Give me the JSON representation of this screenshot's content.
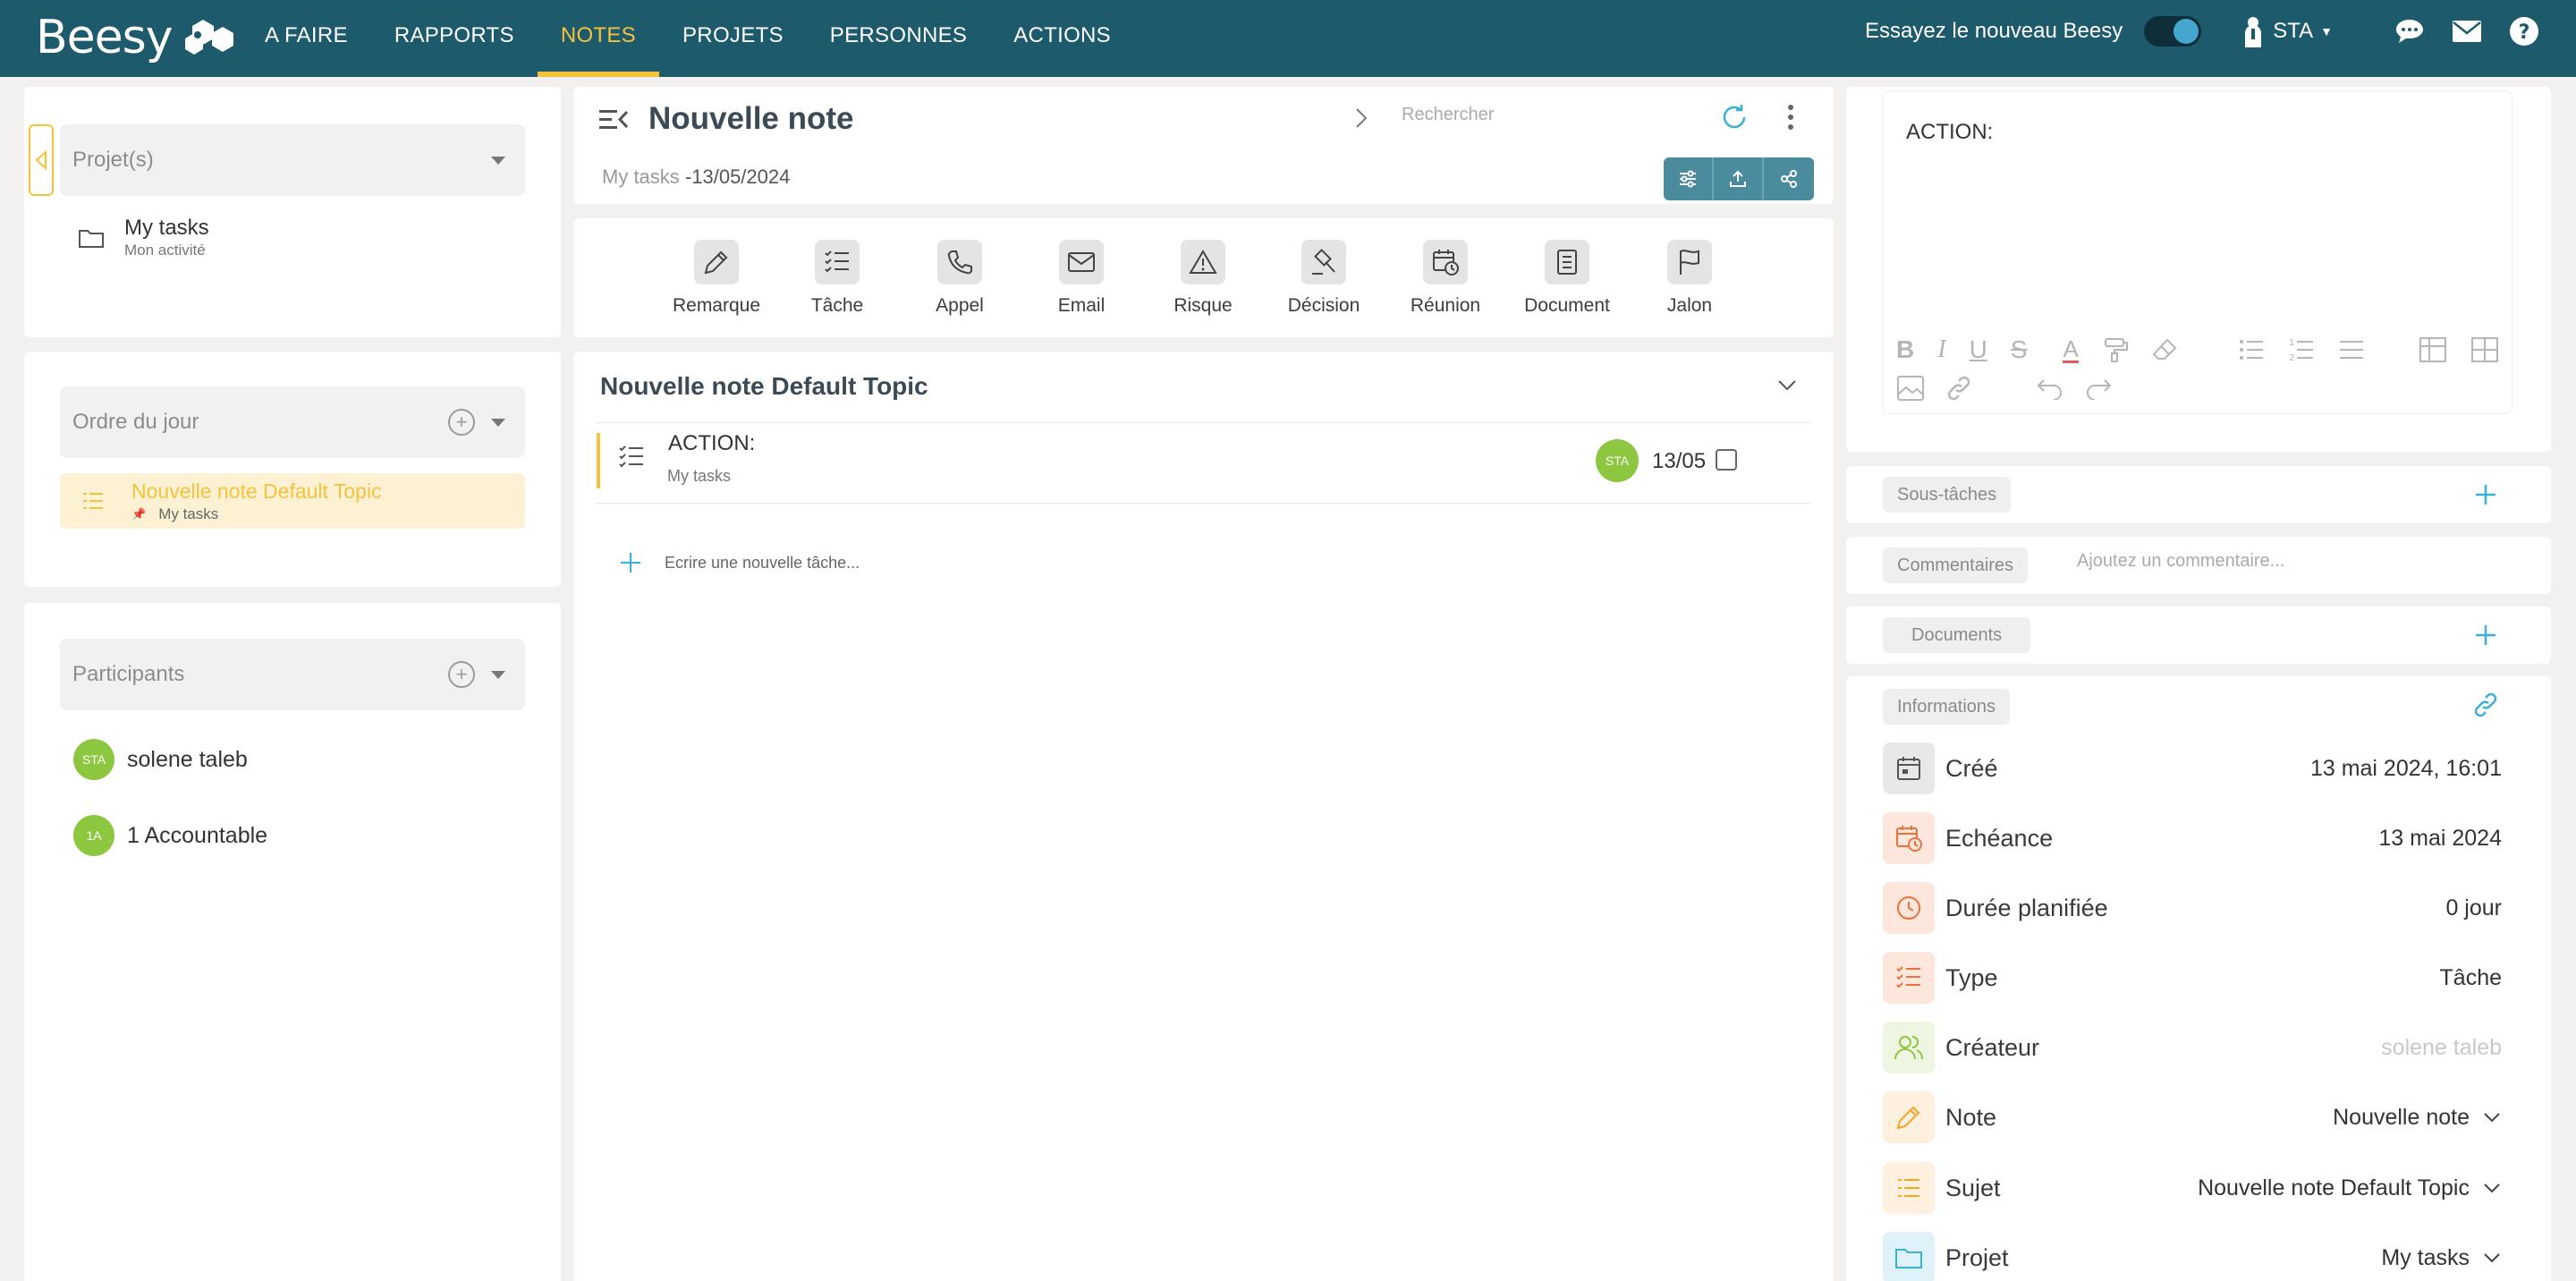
{
  "topbar": {
    "logo": "Beesy",
    "nav": [
      {
        "label": "A FAIRE"
      },
      {
        "label": "RAPPORTS"
      },
      {
        "label": "NOTES"
      },
      {
        "label": "PROJETS"
      },
      {
        "label": "PERSONNES"
      },
      {
        "label": "ACTIONS"
      }
    ],
    "active_nav": "NOTES",
    "try_new": "Essayez le nouveau Beesy",
    "user": "STA"
  },
  "left": {
    "projects_placeholder": "Projet(s)",
    "project": {
      "name": "My tasks",
      "sub": "Mon activité"
    },
    "agenda_placeholder": "Ordre du jour",
    "agenda_item": {
      "title": "Nouvelle note Default Topic",
      "sub": "My tasks"
    },
    "participants_placeholder": "Participants",
    "participants": [
      {
        "initials": "STA",
        "name": "solene taleb"
      },
      {
        "initials": "1A",
        "name": "1 Accountable"
      }
    ]
  },
  "note": {
    "title": "Nouvelle note",
    "search_placeholder": "Rechercher",
    "breadcrumb_project": "My tasks",
    "breadcrumb_date": "-13/05/2024"
  },
  "types": [
    {
      "label": "Remarque",
      "icon": "pencil-icon"
    },
    {
      "label": "Tâche",
      "icon": "checklist-icon"
    },
    {
      "label": "Appel",
      "icon": "phone-icon"
    },
    {
      "label": "Email",
      "icon": "envelope-icon"
    },
    {
      "label": "Risque",
      "icon": "warning-icon"
    },
    {
      "label": "Décision",
      "icon": "gavel-icon"
    },
    {
      "label": "Réunion",
      "icon": "calendar-clock-icon"
    },
    {
      "label": "Document",
      "icon": "document-icon"
    },
    {
      "label": "Jalon",
      "icon": "flag-icon"
    }
  ],
  "topic": {
    "title": "Nouvelle note Default Topic",
    "task": {
      "title": "ACTION:",
      "project": "My tasks",
      "owner": "STA",
      "due": "13/05"
    },
    "new_task_placeholder": "Ecrire une nouvelle tâche..."
  },
  "detail": {
    "editor_text": "ACTION:",
    "subtasks_label": "Sous-tâches",
    "comments_label": "Commentaires",
    "comment_placeholder": "Ajoutez un commentaire...",
    "documents_label": "Documents",
    "info_label": "Informations",
    "info": [
      {
        "label": "Créé",
        "value": "13 mai 2024, 16:01",
        "icon": "calendar-icon",
        "color": "#6b6b6b"
      },
      {
        "label": "Echéance",
        "value": "13 mai 2024",
        "icon": "calendar-due-icon",
        "color": "#e8743b"
      },
      {
        "label": "Durée planifiée",
        "value": "0 jour",
        "icon": "clock-icon",
        "color": "#e8743b"
      },
      {
        "label": "Type",
        "value": "Tâche",
        "icon": "checklist-icon",
        "color": "#e8743b"
      },
      {
        "label": "Créateur",
        "value": "solene taleb",
        "icon": "users-icon",
        "color": "#8dc63f"
      },
      {
        "label": "Note",
        "value": "Nouvelle note",
        "icon": "pencil-icon",
        "color": "#f5a623"
      },
      {
        "label": "Sujet",
        "value": "Nouvelle note Default Topic",
        "icon": "list-icon",
        "color": "#f5a623"
      },
      {
        "label": "Projet",
        "value": "My tasks",
        "icon": "folder-icon",
        "color": "#3ab0d6"
      }
    ]
  },
  "colors": {
    "topbar": "#1c5a6c",
    "accent": "#f5c23a",
    "teal": "#4b8b9e",
    "avatar": "#8dc63f"
  }
}
